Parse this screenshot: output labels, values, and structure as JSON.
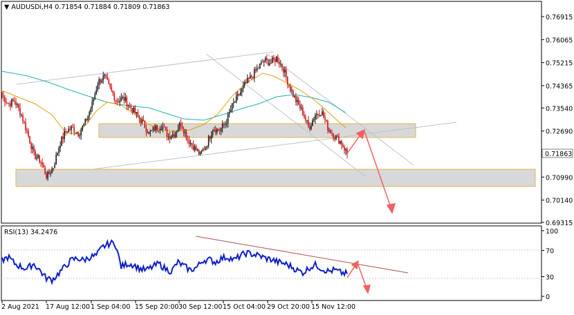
{
  "header": {
    "symbol": "AUDUSDi,H4",
    "ohlc": "0.71854 0.71884 0.71809 0.71863"
  },
  "rsi_header": "RSI(13) 34.2476",
  "chart_data": [
    {
      "type": "candlestick",
      "title": "AUDUSDi,H4",
      "ylim": [
        0.69315,
        0.7723
      ],
      "y_ticks": [
        "0.76915",
        "0.76065",
        "0.75215",
        "0.74365",
        "0.73540",
        "0.72690",
        "0.70990",
        "0.70140",
        "0.69315"
      ],
      "current_price": "0.71863",
      "x_ticks": [
        "2 Aug 2021",
        "17 Aug 12:00",
        "1 Sep 04:00",
        "15 Sep 20:00",
        "30 Sep 12:00",
        "15 Oct 04:00",
        "29 Oct 20:00",
        "15 Nov 12:00"
      ],
      "close_anchors": [
        0.74,
        0.737,
        0.738,
        0.733,
        0.726,
        0.718,
        0.716,
        0.71,
        0.7135,
        0.722,
        0.727,
        0.728,
        0.726,
        0.73,
        0.736,
        0.745,
        0.747,
        0.742,
        0.738,
        0.739,
        0.736,
        0.733,
        0.73,
        0.726,
        0.728,
        0.729,
        0.725,
        0.726,
        0.73,
        0.724,
        0.721,
        0.718,
        0.722,
        0.728,
        0.727,
        0.73,
        0.736,
        0.74,
        0.744,
        0.747,
        0.75,
        0.753,
        0.752,
        0.754,
        0.75,
        0.743,
        0.738,
        0.734,
        0.728,
        0.733,
        0.734,
        0.728,
        0.725,
        0.723,
        0.7186
      ],
      "series": [
        {
          "name": "MA fast",
          "color": "#e0a000"
        },
        {
          "name": "MA slow",
          "color": "#20b0b0"
        }
      ],
      "zones": [
        {
          "from": 0.7289,
          "to": 0.725
        },
        {
          "from": 0.7127,
          "to": 0.7082
        }
      ]
    },
    {
      "type": "line",
      "title": "RSI(13) 34.2476",
      "ylim": [
        0,
        100
      ],
      "y_ticks": [
        "100",
        "70",
        "30",
        "0"
      ],
      "rsi_anchors": [
        55,
        60,
        50,
        45,
        42,
        50,
        40,
        28,
        25,
        35,
        45,
        55,
        58,
        55,
        60,
        62,
        75,
        80,
        82,
        45,
        50,
        48,
        42,
        40,
        45,
        50,
        42,
        38,
        52,
        46,
        40,
        44,
        55,
        56,
        52,
        58,
        60,
        55,
        62,
        66,
        64,
        62,
        58,
        56,
        52,
        50,
        46,
        40,
        36,
        44,
        48,
        42,
        38,
        40,
        36,
        34.25
      ],
      "line_color": "#0a1ec8"
    }
  ]
}
